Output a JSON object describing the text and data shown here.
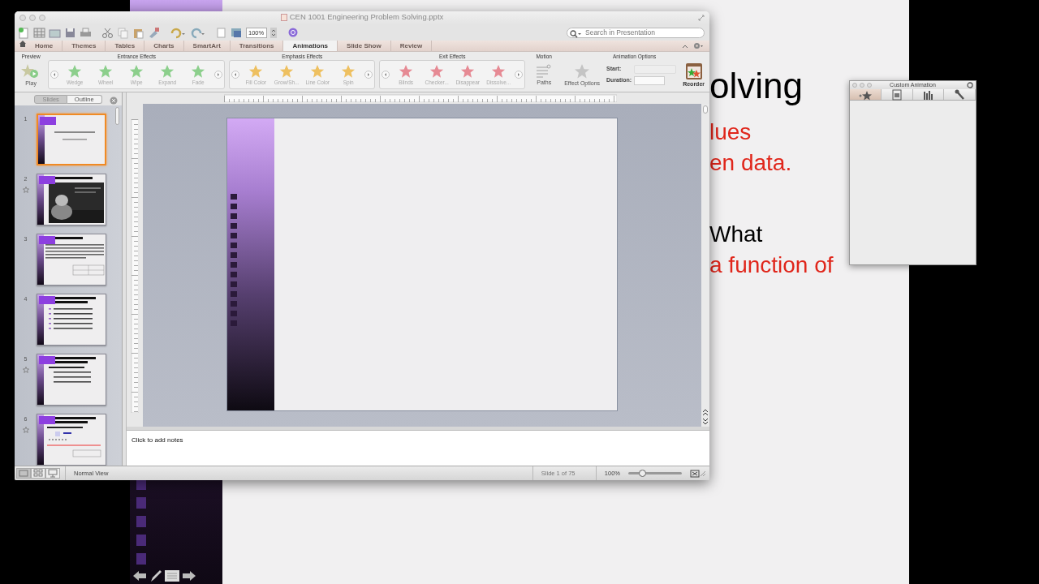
{
  "background_slide": {
    "lines": [
      {
        "text": "olving",
        "kind": "title",
        "color": "#000000"
      },
      {
        "text": "lues",
        "kind": "body",
        "color": "#e0261b"
      },
      {
        "text": "en data.",
        "kind": "body",
        "color": "#e0261b"
      },
      {
        "text": "What",
        "kind": "gap",
        "color": "#000000"
      },
      {
        "text": "a function of",
        "kind": "body",
        "color": "#e0261b"
      }
    ]
  },
  "window": {
    "title": "CEN 1001 Engineering Problem Solving.pptx"
  },
  "toolbar": {
    "zoom": "100%",
    "search_placeholder": "Search in Presentation"
  },
  "ribbon_tabs": [
    {
      "label": "Home",
      "selected": false
    },
    {
      "label": "Themes",
      "selected": false
    },
    {
      "label": "Tables",
      "selected": false
    },
    {
      "label": "Charts",
      "selected": false
    },
    {
      "label": "SmartArt",
      "selected": false
    },
    {
      "label": "Transitions",
      "selected": false
    },
    {
      "label": "Animations",
      "selected": true
    },
    {
      "label": "Slide Show",
      "selected": false
    },
    {
      "label": "Review",
      "selected": false
    }
  ],
  "ribbon": {
    "preview": {
      "title": "Preview",
      "button": "Play"
    },
    "galleries": [
      {
        "title": "Entrance Effects",
        "color": "#8ccf8c",
        "effects": [
          "Wedge",
          "Wheel",
          "Wipe",
          "Expand",
          "Fade"
        ]
      },
      {
        "title": "Emphasis Effects",
        "color": "#eec060",
        "effects": [
          "Fill Color",
          "Grow/Sh...",
          "Line Color",
          "Spin"
        ]
      },
      {
        "title": "Exit Effects",
        "color": "#e68a94",
        "effects": [
          "Blinds",
          "Checker...",
          "Disappear",
          "Dissolve..."
        ]
      }
    ],
    "motion": {
      "title": "Motion",
      "button": "Paths"
    },
    "animation_options": {
      "title": "Animation Options",
      "effect_options": "Effect Options",
      "start_label": "Start:",
      "duration_label": "Duration:",
      "reorder": "Reorder"
    }
  },
  "slide_pane": {
    "tabs": [
      {
        "label": "Slides",
        "selected": true
      },
      {
        "label": "Outline",
        "selected": false
      }
    ],
    "slides": [
      {
        "number": "1",
        "selected": true,
        "animated": false,
        "kind": "title"
      },
      {
        "number": "2",
        "selected": false,
        "animated": true,
        "kind": "picture"
      },
      {
        "number": "3",
        "selected": false,
        "animated": false,
        "kind": "text"
      },
      {
        "number": "4",
        "selected": false,
        "animated": false,
        "kind": "list"
      },
      {
        "number": "5",
        "selected": false,
        "animated": true,
        "kind": "outline"
      },
      {
        "number": "6",
        "selected": false,
        "animated": true,
        "kind": "sketch"
      }
    ]
  },
  "notes": {
    "text": "Click to add notes"
  },
  "status_bar": {
    "views": [
      {
        "kind": "normal",
        "selected": true
      },
      {
        "kind": "sorter",
        "selected": false
      },
      {
        "kind": "show",
        "selected": false
      }
    ],
    "view_name": "Normal View",
    "slide": "Slide 1 of 75",
    "zoom": "100%",
    "level": 0.27
  },
  "custom_animation": {
    "title": "Custom Animation",
    "tabs": [
      {
        "kind": "effects",
        "selected": true
      },
      {
        "kind": "media",
        "selected": false
      },
      {
        "kind": "chart",
        "selected": false
      },
      {
        "kind": "tools",
        "selected": false
      }
    ]
  }
}
